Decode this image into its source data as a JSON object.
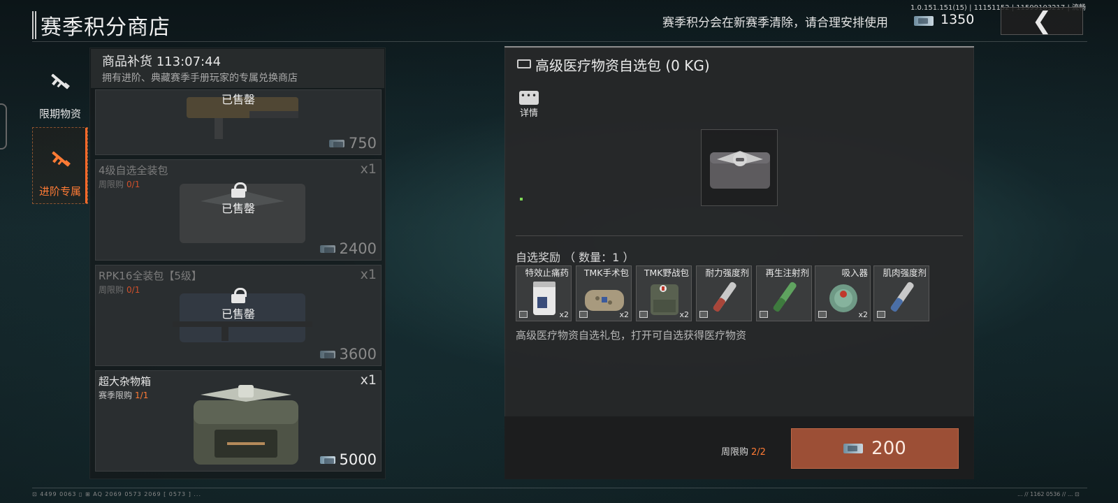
{
  "version": "1.0.151.151(15) | 11151152 | 11599103217 | 流畅",
  "header": {
    "title": "赛季积分商店",
    "notice": "赛季积分会在新赛季清除，请合理安排使用",
    "points": "1350",
    "back_icon": "chevron-left-icon"
  },
  "nav": {
    "items": [
      {
        "label": "限期物资",
        "icon": "rifle-icon",
        "active": false
      },
      {
        "label": "进阶专属",
        "icon": "rifle-icon",
        "active": true
      }
    ]
  },
  "restock": {
    "title": "商品补货 113:07:44",
    "subtitle": "拥有进阶、典藏赛季手册玩家的专属兑换商店"
  },
  "items": [
    {
      "name": "",
      "limit_label": "",
      "limit_value": "",
      "qty": "",
      "price": "750",
      "sold": true,
      "sold_label": "已售罄"
    },
    {
      "name": "4级自选全装包",
      "limit_label": "周限购",
      "limit_value": "0/1",
      "qty": "x1",
      "price": "2400",
      "sold": true,
      "sold_label": "已售罄"
    },
    {
      "name": "RPK16全装包【5级】",
      "limit_label": "周限购",
      "limit_value": "0/1",
      "qty": "x1",
      "price": "3600",
      "sold": true,
      "sold_label": "已售罄"
    },
    {
      "name": "超大杂物箱",
      "limit_label": "赛季限购",
      "limit_value": "1/1",
      "qty": "x1",
      "price": "5000",
      "sold": false
    }
  ],
  "detail": {
    "title": "高级医疗物资自选包 (0 KG)",
    "detail_button": "详情",
    "rewards_title": "自选奖励 （ 数量：1 ）",
    "rewards": [
      {
        "name": "特效止痛药",
        "count": "x2"
      },
      {
        "name": "TMK手术包",
        "count": "x2"
      },
      {
        "name": "TMK野战包",
        "count": "x2"
      },
      {
        "name": "耐力强度剂",
        "count": ""
      },
      {
        "name": "再生注射剂",
        "count": ""
      },
      {
        "name": "吸入器",
        "count": "x2"
      },
      {
        "name": "肌肉强度剂",
        "count": ""
      }
    ],
    "description": "高级医疗物资自选礼包，打开可自选获得医疗物资",
    "weekly_label": "周限购",
    "weekly_value": "2/2",
    "buy_price": "200"
  },
  "hud": {
    "left": "⊡ 4499 0063 ▯   ⊞ AQ 2069 0573   2069  [ 0573 ]  ...",
    "right": "...  // 1162  0536 //  ...  ⊡"
  },
  "colors": {
    "accent_orange": "#ff7b35",
    "buy_button": "#9c4f36",
    "limit_red": "#d0502b"
  }
}
